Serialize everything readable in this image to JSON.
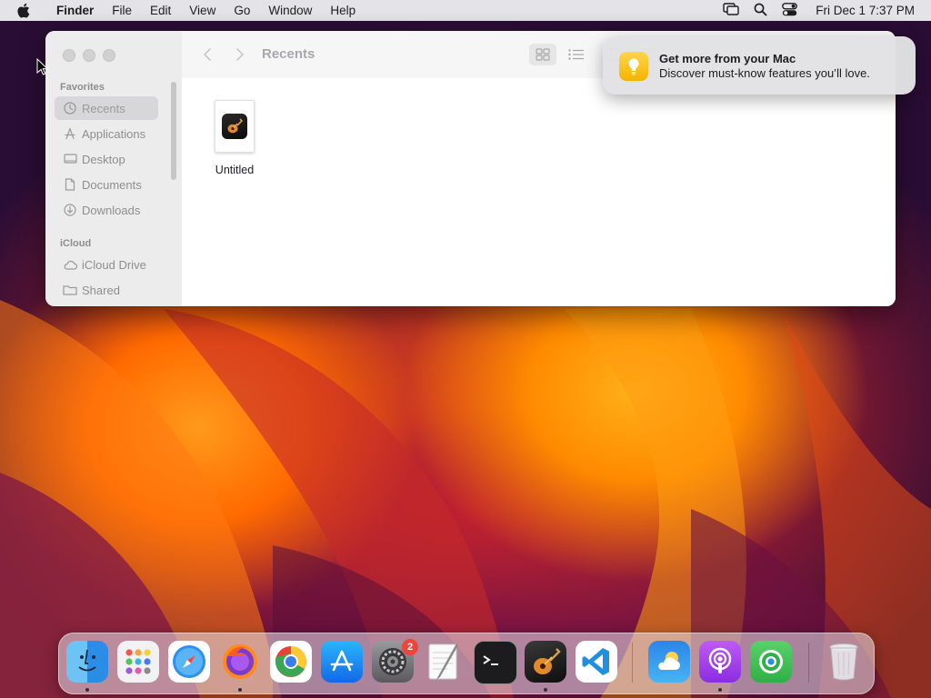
{
  "menubar": {
    "app_name": "Finder",
    "items": [
      "File",
      "Edit",
      "View",
      "Go",
      "Window",
      "Help"
    ],
    "clock": "Fri Dec 1  7:37 PM"
  },
  "finder": {
    "title": "Recents",
    "sidebar": {
      "favorites_heading": "Favorites",
      "favorites": [
        {
          "label": "Recents",
          "icon": "clock-icon",
          "selected": true
        },
        {
          "label": "Applications",
          "icon": "applications-icon"
        },
        {
          "label": "Desktop",
          "icon": "desktop-icon"
        },
        {
          "label": "Documents",
          "icon": "document-icon"
        },
        {
          "label": "Downloads",
          "icon": "download-icon"
        }
      ],
      "icloud_heading": "iCloud",
      "icloud": [
        {
          "label": "iCloud Drive",
          "icon": "cloud-icon"
        },
        {
          "label": "Shared",
          "icon": "shared-folder-icon"
        }
      ]
    },
    "files": [
      {
        "name": "Untitled",
        "icon": "garageband-document-icon"
      }
    ]
  },
  "notification": {
    "title": "Get more from your Mac",
    "body": "Discover must-know features you’ll love."
  },
  "dock": {
    "apps": [
      {
        "name": "Finder",
        "running": true
      },
      {
        "name": "Launchpad"
      },
      {
        "name": "Safari"
      },
      {
        "name": "Firefox",
        "running": true
      },
      {
        "name": "Chrome"
      },
      {
        "name": "App Store"
      },
      {
        "name": "System Settings",
        "badge": "2"
      },
      {
        "name": "TextEdit"
      },
      {
        "name": "Terminal"
      },
      {
        "name": "GarageBand",
        "running": true
      },
      {
        "name": "Visual Studio Code"
      },
      {
        "name": "Weather"
      },
      {
        "name": "Podcasts",
        "running": true
      },
      {
        "name": "Find My"
      },
      {
        "name": "Trash"
      }
    ],
    "settings_badge": "2"
  }
}
